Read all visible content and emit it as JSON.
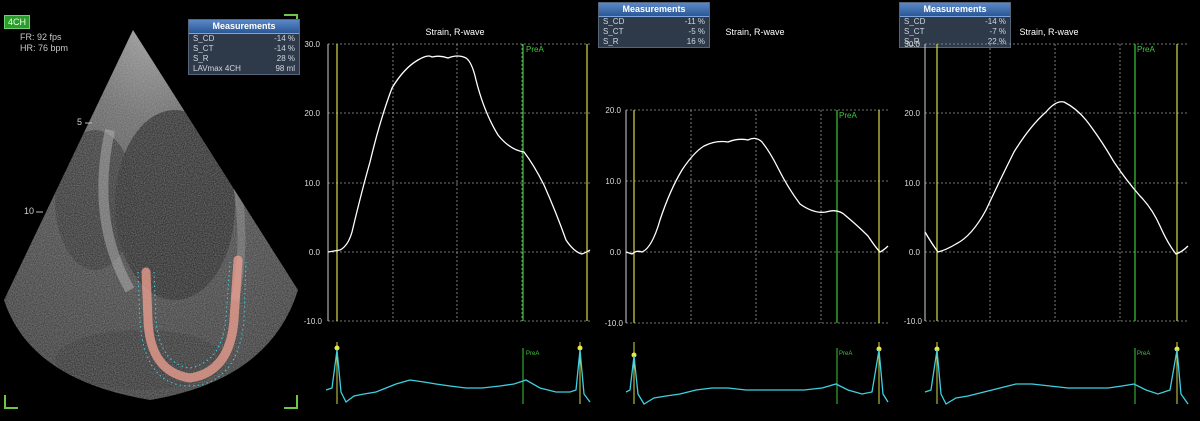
{
  "echo": {
    "view_tag": "4CH",
    "fr": "FR: 92 fps",
    "hr": "HR: 76 bpm",
    "depth_labels": [
      "5",
      "10"
    ]
  },
  "measurements_left": {
    "header": "Measurements",
    "rows": [
      {
        "label": "S_CD",
        "value": "-14 %"
      },
      {
        "label": "S_CT",
        "value": "-14 %"
      },
      {
        "label": "S_R",
        "value": "28 %"
      },
      {
        "label": "LAVmax 4CH",
        "value": "98 ml"
      }
    ]
  },
  "measurements_mid": {
    "header": "Measurements",
    "rows": [
      {
        "label": "S_CD",
        "value": "-11 %"
      },
      {
        "label": "S_CT",
        "value": "-5 %"
      },
      {
        "label": "S_R",
        "value": "16 %"
      }
    ]
  },
  "measurements_right": {
    "header": "Measurements",
    "rows": [
      {
        "label": "S_CD",
        "value": "-14 %"
      },
      {
        "label": "S_CT",
        "value": "-7 %"
      },
      {
        "label": "S_R",
        "value": "22 %"
      }
    ]
  },
  "panels": [
    {
      "title": "Strain, R-wave",
      "marker": "PreA",
      "ylim": [
        -10,
        30
      ],
      "ticks": [
        "30.0",
        "20.0",
        "10.0",
        "0.0",
        "-10.0"
      ]
    },
    {
      "title": "Strain, R-wave",
      "marker": "PreA",
      "ylim": [
        -10,
        20
      ],
      "ticks": [
        "20.0",
        "10.0",
        "0.0",
        "-10.0"
      ]
    },
    {
      "title": "Strain, R-wave",
      "marker": "PreA",
      "ylim": [
        -10,
        30
      ],
      "ticks": [
        "30.0",
        "20.0",
        "10.0",
        "0.0",
        "-10.0"
      ]
    }
  ],
  "colors": {
    "strain_curve": "#ffffff",
    "ecg_trace": "#3fd0e0",
    "marker_yellow": "#d8d84a",
    "marker_green": "#3cc83c",
    "grid": "#9a9a9a",
    "tracing": "#f0a090"
  }
}
